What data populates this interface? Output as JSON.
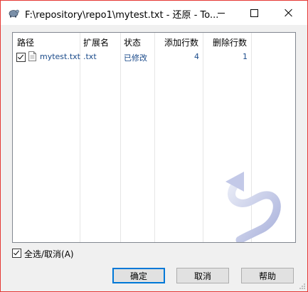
{
  "window": {
    "title": "F:\\repository\\repo1\\mytest.txt - 还原 - To..."
  },
  "list": {
    "columns": [
      "路径",
      "扩展名",
      "状态",
      "添加行数",
      "删除行数"
    ],
    "rows": [
      {
        "checked": true,
        "path": "mytest.txt",
        "extension": ".txt",
        "status": "已修改",
        "added": "4",
        "removed": "1"
      }
    ]
  },
  "select_all": {
    "label": "全选/取消(A)",
    "checked": true
  },
  "buttons": {
    "ok": "确定",
    "cancel": "取消",
    "help": "帮助"
  },
  "colors": {
    "border_accent": "#e53935",
    "cell_text": "#1a4a8a",
    "default_button_border": "#0078d7"
  },
  "icons": {
    "app": "tortoise-icon",
    "file": "text-file-icon",
    "watermark": "revert-swirl-icon"
  }
}
